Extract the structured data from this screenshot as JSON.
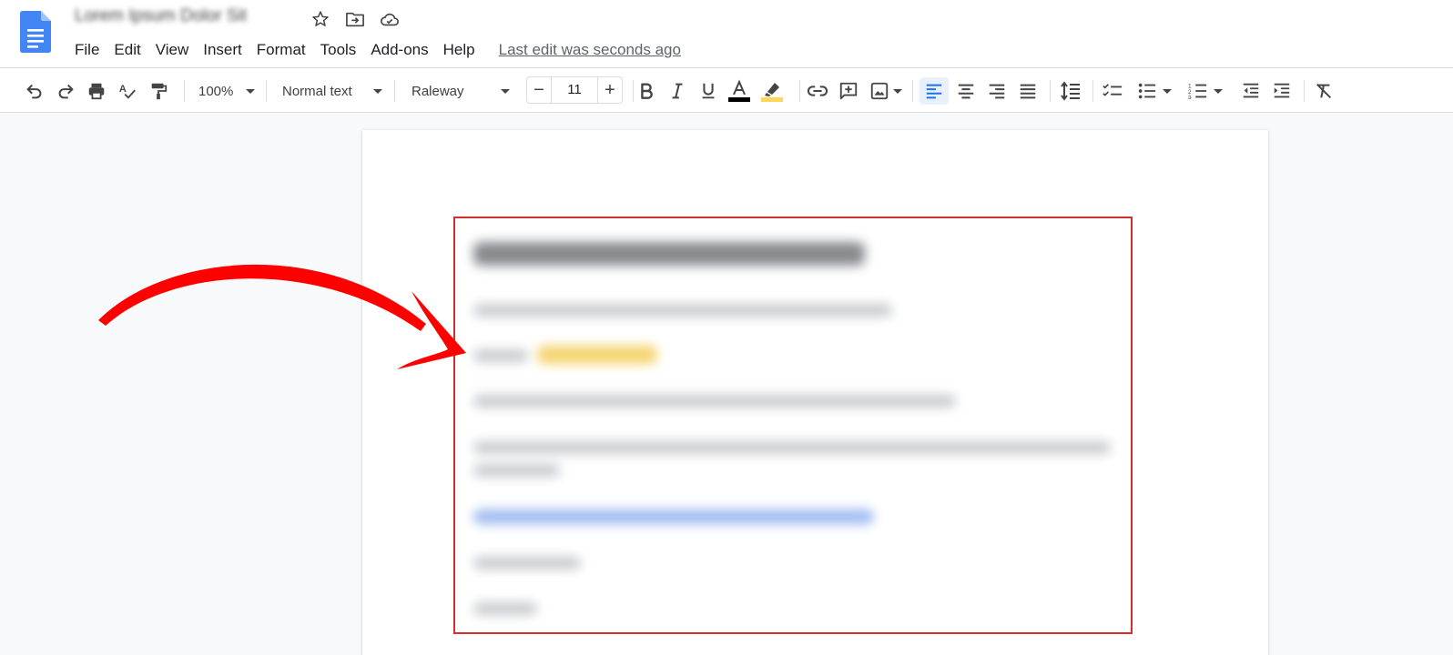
{
  "document": {
    "title": "Lorem Ipsum Dolor Sit"
  },
  "title_actions": [
    "star-icon",
    "move-folder-icon",
    "cloud-saved-icon"
  ],
  "menu": {
    "items": [
      "File",
      "Edit",
      "View",
      "Insert",
      "Format",
      "Tools",
      "Add-ons",
      "Help"
    ],
    "last_edit": "Last edit was seconds ago"
  },
  "toolbar": {
    "zoom": "100%",
    "style": "Normal text",
    "font": "Raleway",
    "font_size": "11",
    "minus_label": "−",
    "plus_label": "+",
    "text_color": "#000000",
    "highlight_color": "#fbd75b",
    "active_align": "left"
  },
  "colors": {
    "accent_blue": "#4285f4",
    "annotation_red": "#ff0000",
    "box_red": "#d32f2f"
  }
}
